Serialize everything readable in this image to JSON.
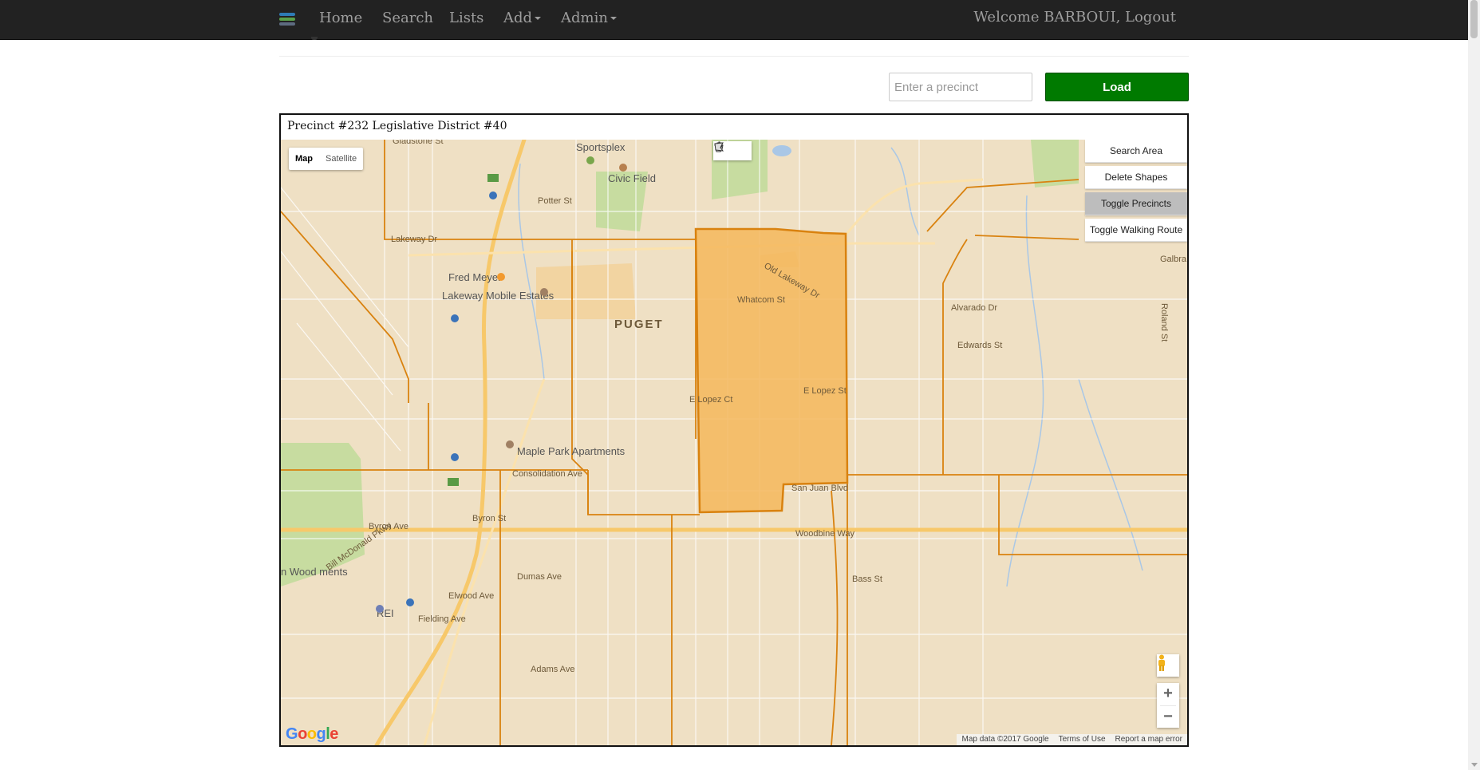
{
  "nav": {
    "brand_icon": "app-logo-icon",
    "home": "Home",
    "search": "Search",
    "lists": "Lists",
    "add": "Add",
    "admin": "Admin",
    "welcome": "Welcome BARBOUI, Logout"
  },
  "loader": {
    "placeholder": "Enter a precinct",
    "load_label": "Load"
  },
  "panel": {
    "title": "Precinct #232 Legislative District #40"
  },
  "map": {
    "type_map": "Map",
    "type_satellite": "Satellite",
    "buttons": {
      "search_area": "Search Area",
      "delete_shapes": "Delete Shapes",
      "toggle_precincts": "Toggle Precincts",
      "toggle_walking_route": "Toggle Walking Route"
    },
    "zoom_in": "+",
    "zoom_out": "−",
    "google": "Google",
    "attribution": {
      "data": "Map data ©2017 Google",
      "terms": "Terms of Use",
      "report": "Report a map error"
    },
    "labels": {
      "sportsplex": "Sportsplex",
      "civic_field": "Civic Field",
      "fred_meyer": "Fred Meyer",
      "lakeway_mobile": "Lakeway Mobile Estates",
      "puget": "PUGET",
      "whatcom_st": "Whatcom St",
      "maple_park": "Maple Park Apartments",
      "consolidation": "Consolidation Ave",
      "san_juan": "San Juan Blvd",
      "woodbine": "Woodbine Way",
      "bass_st": "Bass St",
      "lakeway_dr": "Lakeway Dr",
      "potter_st": "Potter St",
      "edwards_st": "Edwards St",
      "alvarado_dr": "Alvarado Dr",
      "e_lopez_st": "E Lopez St",
      "e_lopez_ct": "E Lopez Ct",
      "byron_st": "Byron St",
      "byron_ave": "Byron Ave",
      "dumas_ave": "Dumas Ave",
      "elwood_ave": "Elwood Ave",
      "fielding_ave": "Fielding Ave",
      "adams_ave": "Adams Ave",
      "rei": "REI",
      "wood_homes": "n Wood\nments",
      "gladstone_st": "Gladstone St",
      "old_lakeway": "Old Lakeway Dr",
      "roland_st": "Roland St",
      "galbraith": "Galbra\nPar",
      "bill_mcdonald": "Bill McDonald Pkwy"
    },
    "colors": {
      "precinct_fill": "#f5b75c",
      "precinct_stroke": "#d9820f",
      "road_major": "#f7c86a",
      "park": "#c7dca0",
      "water": "#a9c7e6"
    }
  }
}
